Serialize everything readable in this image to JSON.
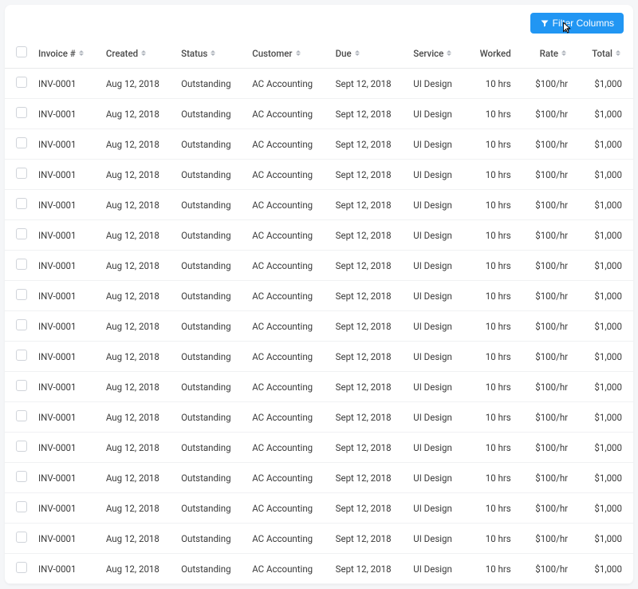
{
  "toolbar": {
    "filter_label": "Filter Columns"
  },
  "table": {
    "columns": [
      {
        "key": "invoice",
        "label": "Invoice #",
        "sortable": true
      },
      {
        "key": "created",
        "label": "Created",
        "sortable": true
      },
      {
        "key": "status",
        "label": "Status",
        "sortable": true
      },
      {
        "key": "customer",
        "label": "Customer",
        "sortable": true
      },
      {
        "key": "due",
        "label": "Due",
        "sortable": true
      },
      {
        "key": "service",
        "label": "Service",
        "sortable": true
      },
      {
        "key": "worked",
        "label": "Worked",
        "sortable": false
      },
      {
        "key": "rate",
        "label": "Rate",
        "sortable": true
      },
      {
        "key": "total",
        "label": "Total",
        "sortable": true
      }
    ],
    "rows": [
      {
        "invoice": "INV-0001",
        "created": "Aug 12, 2018",
        "status": "Outstanding",
        "customer": "AC Accounting",
        "due": "Sept 12, 2018",
        "service": "UI Design",
        "worked": "10 hrs",
        "rate": "$100/hr",
        "total": "$1,000"
      },
      {
        "invoice": "INV-0001",
        "created": "Aug 12, 2018",
        "status": "Outstanding",
        "customer": "AC Accounting",
        "due": "Sept 12, 2018",
        "service": "UI Design",
        "worked": "10 hrs",
        "rate": "$100/hr",
        "total": "$1,000"
      },
      {
        "invoice": "INV-0001",
        "created": "Aug 12, 2018",
        "status": "Outstanding",
        "customer": "AC Accounting",
        "due": "Sept 12, 2018",
        "service": "UI Design",
        "worked": "10 hrs",
        "rate": "$100/hr",
        "total": "$1,000"
      },
      {
        "invoice": "INV-0001",
        "created": "Aug 12, 2018",
        "status": "Outstanding",
        "customer": "AC Accounting",
        "due": "Sept 12, 2018",
        "service": "UI Design",
        "worked": "10 hrs",
        "rate": "$100/hr",
        "total": "$1,000"
      },
      {
        "invoice": "INV-0001",
        "created": "Aug 12, 2018",
        "status": "Outstanding",
        "customer": "AC Accounting",
        "due": "Sept 12, 2018",
        "service": "UI Design",
        "worked": "10 hrs",
        "rate": "$100/hr",
        "total": "$1,000"
      },
      {
        "invoice": "INV-0001",
        "created": "Aug 12, 2018",
        "status": "Outstanding",
        "customer": "AC Accounting",
        "due": "Sept 12, 2018",
        "service": "UI Design",
        "worked": "10 hrs",
        "rate": "$100/hr",
        "total": "$1,000"
      },
      {
        "invoice": "INV-0001",
        "created": "Aug 12, 2018",
        "status": "Outstanding",
        "customer": "AC Accounting",
        "due": "Sept 12, 2018",
        "service": "UI Design",
        "worked": "10 hrs",
        "rate": "$100/hr",
        "total": "$1,000"
      },
      {
        "invoice": "INV-0001",
        "created": "Aug 12, 2018",
        "status": "Outstanding",
        "customer": "AC Accounting",
        "due": "Sept 12, 2018",
        "service": "UI Design",
        "worked": "10 hrs",
        "rate": "$100/hr",
        "total": "$1,000"
      },
      {
        "invoice": "INV-0001",
        "created": "Aug 12, 2018",
        "status": "Outstanding",
        "customer": "AC Accounting",
        "due": "Sept 12, 2018",
        "service": "UI Design",
        "worked": "10 hrs",
        "rate": "$100/hr",
        "total": "$1,000"
      },
      {
        "invoice": "INV-0001",
        "created": "Aug 12, 2018",
        "status": "Outstanding",
        "customer": "AC Accounting",
        "due": "Sept 12, 2018",
        "service": "UI Design",
        "worked": "10 hrs",
        "rate": "$100/hr",
        "total": "$1,000"
      },
      {
        "invoice": "INV-0001",
        "created": "Aug 12, 2018",
        "status": "Outstanding",
        "customer": "AC Accounting",
        "due": "Sept 12, 2018",
        "service": "UI Design",
        "worked": "10 hrs",
        "rate": "$100/hr",
        "total": "$1,000"
      },
      {
        "invoice": "INV-0001",
        "created": "Aug 12, 2018",
        "status": "Outstanding",
        "customer": "AC Accounting",
        "due": "Sept 12, 2018",
        "service": "UI Design",
        "worked": "10 hrs",
        "rate": "$100/hr",
        "total": "$1,000"
      },
      {
        "invoice": "INV-0001",
        "created": "Aug 12, 2018",
        "status": "Outstanding",
        "customer": "AC Accounting",
        "due": "Sept 12, 2018",
        "service": "UI Design",
        "worked": "10 hrs",
        "rate": "$100/hr",
        "total": "$1,000"
      },
      {
        "invoice": "INV-0001",
        "created": "Aug 12, 2018",
        "status": "Outstanding",
        "customer": "AC Accounting",
        "due": "Sept 12, 2018",
        "service": "UI Design",
        "worked": "10 hrs",
        "rate": "$100/hr",
        "total": "$1,000"
      },
      {
        "invoice": "INV-0001",
        "created": "Aug 12, 2018",
        "status": "Outstanding",
        "customer": "AC Accounting",
        "due": "Sept 12, 2018",
        "service": "UI Design",
        "worked": "10 hrs",
        "rate": "$100/hr",
        "total": "$1,000"
      },
      {
        "invoice": "INV-0001",
        "created": "Aug 12, 2018",
        "status": "Outstanding",
        "customer": "AC Accounting",
        "due": "Sept 12, 2018",
        "service": "UI Design",
        "worked": "10 hrs",
        "rate": "$100/hr",
        "total": "$1,000"
      },
      {
        "invoice": "INV-0001",
        "created": "Aug 12, 2018",
        "status": "Outstanding",
        "customer": "AC Accounting",
        "due": "Sept 12, 2018",
        "service": "UI Design",
        "worked": "10 hrs",
        "rate": "$100/hr",
        "total": "$1,000"
      }
    ]
  }
}
